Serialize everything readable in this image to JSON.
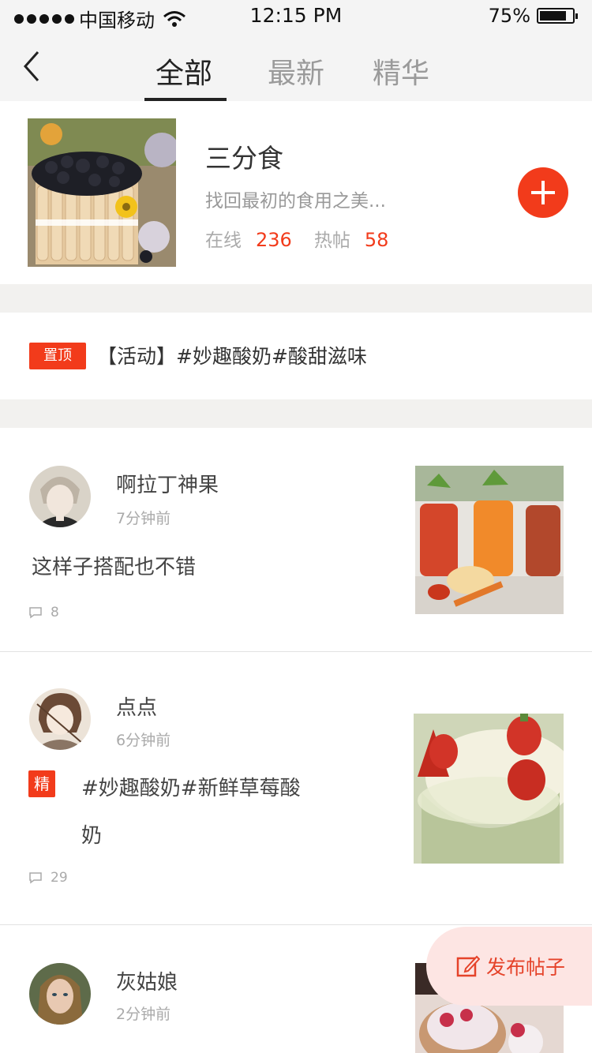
{
  "status_bar": {
    "carrier": "中国移动",
    "time": "12:15 PM",
    "battery": "75%",
    "battery_level": 0.75
  },
  "nav": {
    "tabs": [
      {
        "label": "全部",
        "active": true
      },
      {
        "label": "最新",
        "active": false
      },
      {
        "label": "精华",
        "active": false
      }
    ]
  },
  "group": {
    "name": "三分食",
    "description": "找回最初的食用之美...",
    "online_label": "在线",
    "online_count": "236",
    "hot_label": "热帖",
    "hot_count": "58"
  },
  "pinned": {
    "badge": "置顶",
    "title": "【活动】#妙趣酸奶#酸甜滋味"
  },
  "posts": [
    {
      "author": "啊拉丁神果",
      "time": "7分钟前",
      "text": "这样子搭配也不错",
      "comments": "8",
      "featured": false
    },
    {
      "author": "点点",
      "time": "6分钟前",
      "featured_badge": "精",
      "text_line1": "#妙趣酸奶#新鲜草莓酸",
      "text_line2": "奶",
      "comments": "29",
      "featured": true
    },
    {
      "author": "灰姑娘",
      "time": "2分钟前",
      "featured": false
    }
  ],
  "fab": {
    "label": "发布帖子"
  },
  "colors": {
    "accent": "#f23b1b",
    "fab_background": "#fde5e3",
    "separator": "#f2f1ef"
  }
}
